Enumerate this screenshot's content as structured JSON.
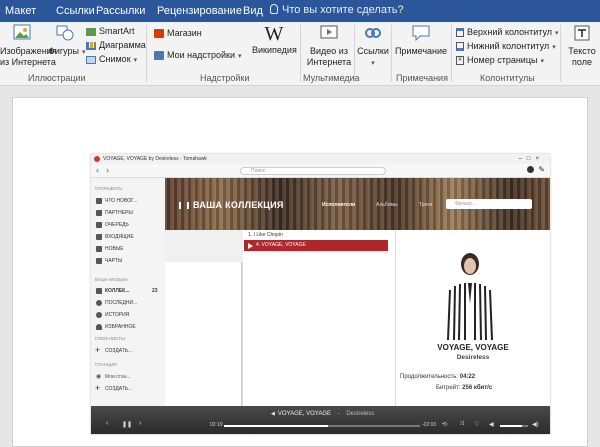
{
  "tabs": [
    "Макет",
    "Ссылки",
    "Рассылки",
    "Рецензирование",
    "Вид"
  ],
  "tell_me": "Что вы хотите сделать?",
  "ribbon": {
    "images_online": "Изображения",
    "images_online2": "из Интернета",
    "shapes": "Фигуры",
    "smartart": "SmartArt",
    "chart": "Диаграмма",
    "screenshot": "Снимок",
    "group_illustrations": "Иллюстрации",
    "store": "Магазин",
    "my_addins": "Мои надстройки",
    "wikipedia": "Википедия",
    "group_addins": "Надстройки",
    "online_video": "Видео из",
    "online_video2": "Интернета",
    "group_media": "Мультимедиа",
    "links": "Ссылки",
    "comment": "Примечание",
    "group_comments": "Примечания",
    "header": "Верхний колонтитул",
    "footer": "Нижний колонтитул",
    "page_number": "Номер страницы",
    "group_header_footer": "Колонтитулы",
    "textbox": "Тексто",
    "textbox2": "поле"
  },
  "tomahawk": {
    "title": "VOYAGE, VOYAGE by Desireless - Tomahawk",
    "search_placeholder": "Поиск",
    "sidebar": {
      "section_open": "ОТКРЫВАТЬ",
      "whats_new": "ЧТО НОВОГ...",
      "partners": "ПАРТНЕРЫ",
      "queue": "ОЧЕРЕДЬ",
      "inbox": "ВХОДЯЩИЕ",
      "new": "НОВЫЕ",
      "charts": "ЧАРТЫ",
      "section_music": "ВАША МУЗЫКА",
      "collection": "КОЛЛЕК...",
      "collection_count": "23",
      "recent": "ПОСЛЕДНИ...",
      "history": "ИСТОРИЯ",
      "favorites": "ИЗБРАННОЕ",
      "section_playlists": "ПЛЕЙ-ЛИСТЫ",
      "create_playlist": "СОЗДАТЬ...",
      "section_stations": "СТАНЦИИ",
      "my_station": "Мои стан...",
      "create_station": "СОЗДАТЬ..."
    },
    "banner_title": "ВАША КОЛЛЕКЦИЯ",
    "banner_tabs": [
      "Исполнители",
      "Альбомы",
      "Треки"
    ],
    "banner_search": "Фильтр...",
    "tracks": [
      "1. I Like Chopin",
      "4. VOYAGE, VOYAGE"
    ],
    "now_title": "VOYAGE, VOYAGE",
    "now_artist": "Desireless",
    "duration_label": "Продолжительность:",
    "duration_value": "04:22",
    "bitrate_label": "Битрейт:",
    "bitrate_value": "256 кбит/с",
    "player": {
      "title": "VOYAGE, VOYAGE",
      "sep": "-",
      "artist": "Desireless",
      "elapsed": "02:19",
      "remaining": "-02:03",
      "progress": 0.53,
      "volume": 0.8
    }
  }
}
